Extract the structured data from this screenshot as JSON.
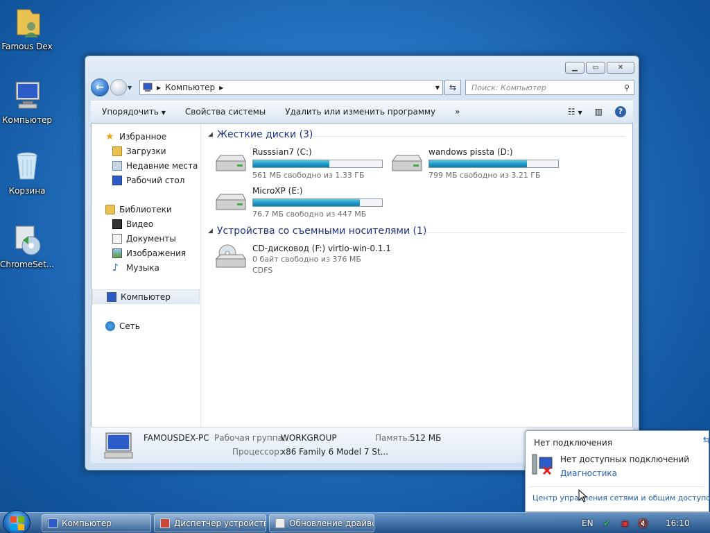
{
  "desktop": {
    "icons": [
      {
        "label": "Famous Dex",
        "icon": "user-folder-icon"
      },
      {
        "label": "Компьютер",
        "icon": "computer-icon"
      },
      {
        "label": "Корзина",
        "icon": "recycle-bin-icon"
      },
      {
        "label": "ChromeSet...",
        "icon": "installer-icon"
      }
    ]
  },
  "window": {
    "address": {
      "root_label": "Компьютер"
    },
    "search": {
      "placeholder": "Поиск: Компьютер"
    },
    "toolbar": {
      "organize": "Упорядочить",
      "system_properties": "Свойства системы",
      "uninstall": "Удалить или изменить программу",
      "more": "»"
    },
    "nav": {
      "favorites": "Избранное",
      "downloads": "Загрузки",
      "recent": "Недавние места",
      "desktop": "Рабочий стол",
      "libraries": "Библиотеки",
      "video": "Видео",
      "documents": "Документы",
      "images": "Изображения",
      "music": "Музыка",
      "computer": "Компьютер",
      "network": "Сеть"
    },
    "groups": {
      "hdd_title": "Жесткие диски (3)",
      "removable_title": "Устройства со съемными носителями (1)"
    },
    "drives": [
      {
        "name": "Russsian7  (C:)",
        "free": "561 МБ свободно из 1.33 ГБ",
        "used_fraction": 0.59
      },
      {
        "name": "wandows pissta (D:)",
        "free": "799 МБ свободно из 3.21 ГБ",
        "used_fraction": 0.76
      },
      {
        "name": "MicroXP (E:)",
        "free": "76.7 МБ свободно из 447 МБ",
        "used_fraction": 0.83
      }
    ],
    "cd": {
      "name": "CD-дисковод (F:) virtio-win-0.1.1",
      "free": "0 байт свободно из 376 МБ",
      "fs": "CDFS"
    },
    "details": {
      "pc_name": "FAMOUSDEX-PC",
      "workgroup_label": "Рабочая группа:",
      "workgroup": "WORKGROUP",
      "memory_label": "Память:",
      "memory": "512 МБ",
      "cpu_label": "Процессор:",
      "cpu": "x86 Family 6 Model 7 St..."
    }
  },
  "network_popup": {
    "title": "Нет подключения",
    "status": "Нет доступных подключений",
    "diagnostics": "Диагностика",
    "center_link": "Центр управления сетями и общим доступо"
  },
  "taskbar": {
    "items": [
      "Компьютер",
      "Диспетчер устройств",
      "Обновление драйве..."
    ],
    "lang": "EN",
    "clock": "16:10"
  },
  "colors": {
    "accent": "#1e3287",
    "link": "#1f5fae",
    "drive_fill": "#1a95c0"
  }
}
